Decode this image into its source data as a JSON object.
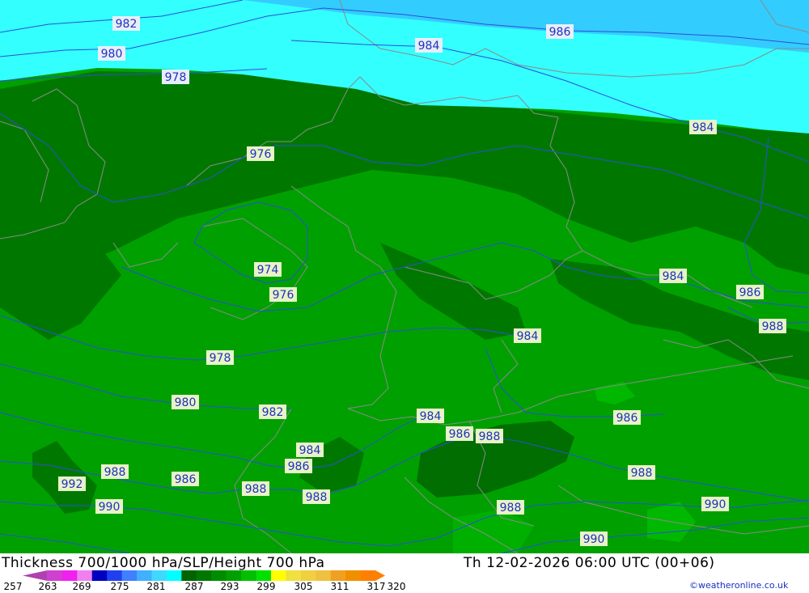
{
  "title": "Thickness 700/1000 hPa/SLP/Height 700 hPa",
  "valid_time": "Th 12-02-2026 06:00 UTC (00+06)",
  "credit": "©weatheronline.co.uk",
  "colors": {
    "sea_light": "#33ffff",
    "sea_blue": "#33ccff",
    "green_1": "#00a000",
    "green_2": "#008c00",
    "green_3": "#007800",
    "green_4": "#006400",
    "green_5": "#00c000",
    "isobar": "#2a4fd8",
    "border": "#8a8a8a"
  },
  "legend": {
    "ticks": [
      "257",
      "263",
      "269",
      "275",
      "281",
      "287",
      "293",
      "299",
      "305",
      "311",
      "317",
      "320"
    ],
    "colors": [
      "#b040b0",
      "#d040d0",
      "#f020f0",
      "#f080f0",
      "#0000c0",
      "#2040f0",
      "#4080ff",
      "#40b0ff",
      "#40d8ff",
      "#00ffff",
      "#006400",
      "#007800",
      "#008c00",
      "#00a000",
      "#00c000",
      "#00e000",
      "#ffff00",
      "#f0e040",
      "#f0d040",
      "#f0c040",
      "#f0a020",
      "#f09000",
      "#ff8000"
    ]
  },
  "isobar_labels": [
    "982",
    "980",
    "978",
    "984",
    "986",
    "984",
    "976",
    "974",
    "976",
    "978",
    "980",
    "982",
    "984",
    "984",
    "984",
    "986",
    "988",
    "984",
    "986",
    "988",
    "986",
    "988",
    "988",
    "986",
    "992",
    "990",
    "988",
    "988",
    "990",
    "990",
    "986",
    "986",
    "988"
  ]
}
